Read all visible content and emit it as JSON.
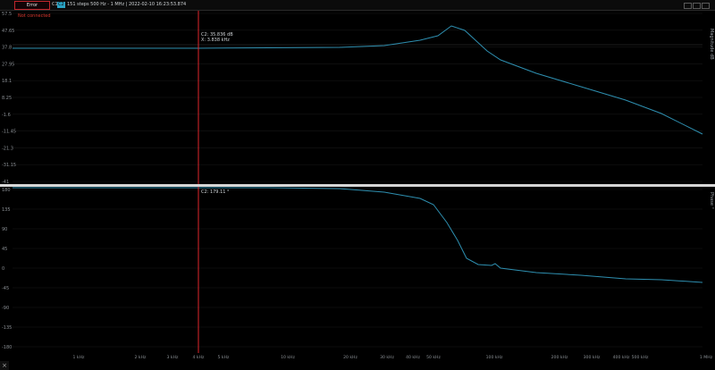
{
  "toolbar": {
    "error_label": "Error",
    "c1_label": "C1",
    "c2_label": "C2",
    "sweep_info": "151 steps  500 Hz - 1 MHz  |  2022-02-10 16:23:53.874"
  },
  "status": {
    "not_connected": "Not connected"
  },
  "magnitude_panel": {
    "side_label": "Magnitude  dB",
    "y_ticks": [
      "57.5",
      "47.65",
      "37.8",
      "27.95",
      "18.1",
      "8.25",
      "-1.6",
      "-11.45",
      "-21.3",
      "-31.15",
      "-41"
    ],
    "cursor_readout_value": "C2:  35.836  dB",
    "cursor_readout_freq": "X:  3.838  kHz"
  },
  "phase_panel": {
    "side_label": "Phase  °",
    "y_ticks": [
      "180",
      "135",
      "90",
      "45",
      "0",
      "-45",
      "-90",
      "-135",
      "-180"
    ],
    "cursor_readout_value": "C2:  179.11  °"
  },
  "x_axis": {
    "ticks": [
      "1 kHz",
      "2 kHz",
      "3 kHz",
      "4 kHz",
      "5 kHz",
      "10 kHz",
      "20 kHz",
      "30 kHz",
      "40 kHz",
      "50 kHz",
      "100 kHz",
      "200 kHz",
      "300 kHz",
      "400 kHz",
      "500 kHz",
      "1 MHz"
    ]
  },
  "colors": {
    "trace": "#2e8fb0",
    "cursor": "#e0262c",
    "error": "#d9382e"
  },
  "close_glyph": "×"
}
